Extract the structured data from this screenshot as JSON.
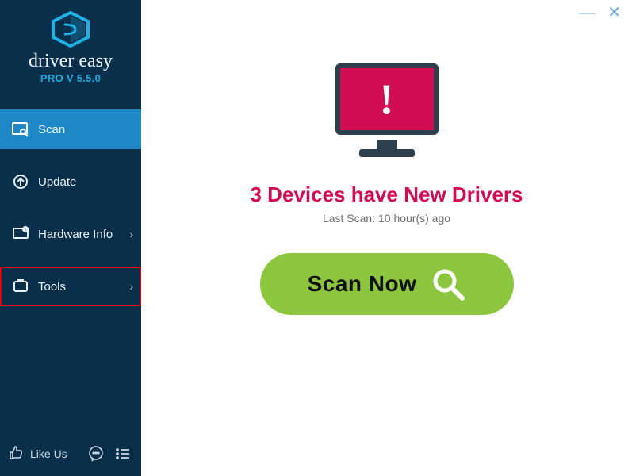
{
  "brand": {
    "name": "driver easy",
    "version": "PRO V 5.5.0"
  },
  "nav": [
    {
      "label": "Scan",
      "has_chevron": false,
      "active": true
    },
    {
      "label": "Update",
      "has_chevron": false
    },
    {
      "label": "Hardware Info",
      "has_chevron": true
    },
    {
      "label": "Tools",
      "has_chevron": true,
      "highlighted": true
    }
  ],
  "footer": {
    "like_label": "Like Us"
  },
  "main": {
    "headline": "3 Devices have New Drivers",
    "subline": "Last Scan: 10 hour(s) ago",
    "scan_button_label": "Scan Now"
  }
}
